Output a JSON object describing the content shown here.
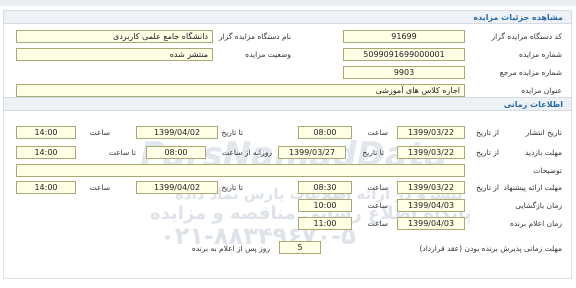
{
  "panel1": {
    "title": "مشاهده جزئیات مزایده",
    "fields": {
      "organizer_code_label": "کد دستگاه مزایده گزار",
      "organizer_code_value": "91699",
      "organizer_name_label": "نام دستگاه مزایده گزار",
      "organizer_name_value": "دانشگاه جامع علمی کاربردی",
      "auction_number_label": "شماره مزایده",
      "auction_number_value": "5099091699000001",
      "auction_status_label": "وضعیت مزایده",
      "auction_status_value": "منتشر شده",
      "reference_number_label": "شماره مزایده مرجع",
      "reference_number_value": "9903",
      "auction_title_label": "عنوان مزایده",
      "auction_title_value": "اجاره کلاس های آموزشی"
    }
  },
  "panel2": {
    "title": "اطلاعات زمانی",
    "publish": {
      "label": "تاریخ انتشار",
      "from_label": "از تاریخ",
      "from_date": "1399/03/22",
      "from_time_label": "ساعت",
      "from_time": "08:00",
      "to_label": "تا تاریخ",
      "to_date": "1399/04/02",
      "to_time_label": "ساعت",
      "to_time": "14:00"
    },
    "visit": {
      "label": "مهلت بازدید",
      "from_label": "از تاریخ",
      "from_date": "1399/03/22",
      "to_label": "تا تاریخ",
      "to_date": "1399/03/27",
      "daily_from_label": "روزانه از ساعت",
      "daily_from": "08:00",
      "daily_to_label": "تا ساعت",
      "daily_to": "14:00"
    },
    "notes_label": "توضیحات",
    "offer": {
      "label": "مهلت ارائه پیشنهاد",
      "from_label": "از تاریخ",
      "from_date": "1399/03/22",
      "from_time_label": "ساعت",
      "from_time": "08:30",
      "to_label": "تا تاریخ",
      "to_date": "1399/04/02",
      "to_time_label": "ساعت",
      "to_time": "14:00"
    },
    "opening": {
      "label": "زمان بازگشایی",
      "date": "1399/04/03",
      "time_label": "ساعت",
      "time": "10:00"
    },
    "winner": {
      "label": "زمان اعلام برنده",
      "date": "1399/04/03",
      "time_label": "ساعت",
      "time": "11:00"
    },
    "deadline": {
      "label": "مهلت زمانی پذیرش برنده بودن (عقد قرارداد)",
      "value": "5",
      "suffix": "روز پس از اعلام به برنده"
    }
  },
  "watermark": {
    "logo_text": "ParsNamadData",
    "line1": "پیشرو در ارائه اطلاعات پارس نماد داده",
    "line2": "پایگاه اطلاع رسانی مناقصه و مزایده",
    "phone": "۰۲۱-۸۸۳۴۹۶۷۰-۵"
  }
}
